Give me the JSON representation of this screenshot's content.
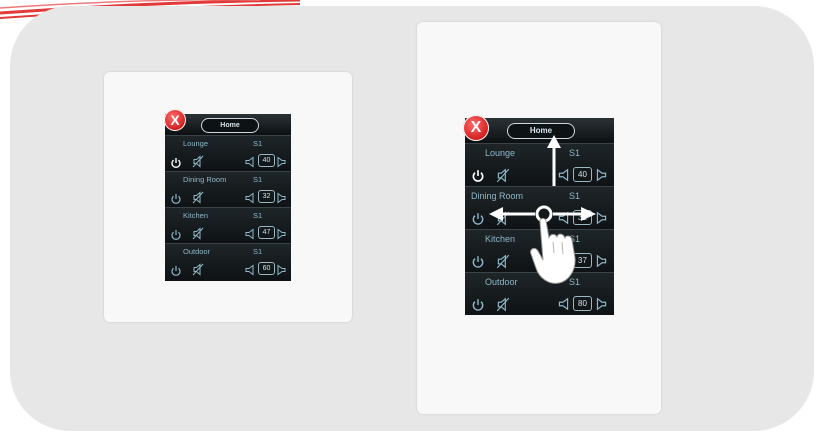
{
  "colors": {
    "background": "#e7e7e7",
    "screen": "#0d1113",
    "accent_text": "#8fb7c8",
    "close_red": "#d01c1c"
  },
  "panel_small": {
    "close_glyph": "X",
    "home_label": "Home",
    "zones": [
      {
        "name": "Lounge",
        "source": "S1",
        "volume": "40",
        "power_on": true
      },
      {
        "name": "Dining Room",
        "source": "S1",
        "volume": "32",
        "power_on": false
      },
      {
        "name": "Kitchen",
        "source": "S1",
        "volume": "47",
        "power_on": false
      },
      {
        "name": "Outdoor",
        "source": "S1",
        "volume": "60",
        "power_on": false
      }
    ]
  },
  "panel_large": {
    "close_glyph": "X",
    "home_label": "Home",
    "zones": [
      {
        "name": "Lounge",
        "source": "S1",
        "volume": "40",
        "power_on": true
      },
      {
        "name": "Dining Room",
        "source": "S1",
        "volume": "32",
        "power_on": false
      },
      {
        "name": "Kitchen",
        "source": "S1",
        "volume": "37",
        "power_on": false
      },
      {
        "name": "Outdoor",
        "source": "S1",
        "volume": "80",
        "power_on": false
      }
    ]
  },
  "gesture": {
    "icons": [
      "hand-pointer-icon",
      "swipe-up-arrow-icon",
      "swipe-left-arrow-icon",
      "swipe-right-arrow-icon"
    ]
  }
}
